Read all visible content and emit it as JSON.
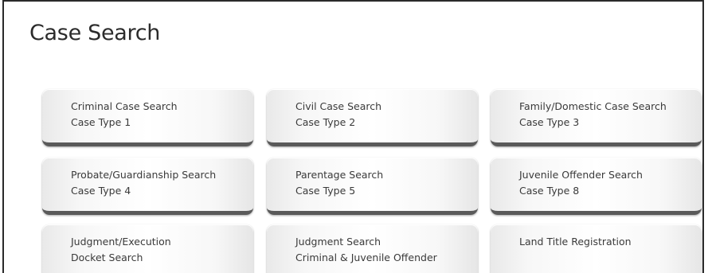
{
  "page": {
    "title": "Case Search"
  },
  "tiles": [
    {
      "line1": "Criminal Case Search",
      "line2": "Case Type 1"
    },
    {
      "line1": "Civil Case Search",
      "line2": "Case Type 2"
    },
    {
      "line1": "Family/Domestic Case Search",
      "line2": "Case Type 3"
    },
    {
      "line1": "Probate/Guardianship Search",
      "line2": "Case Type 4"
    },
    {
      "line1": "Parentage Search",
      "line2": "Case Type 5"
    },
    {
      "line1": "Juvenile Offender Search",
      "line2": "Case Type 8"
    },
    {
      "line1": "Judgment/Execution",
      "line2": "Docket Search"
    },
    {
      "line1": "Judgment Search",
      "line2": "Criminal & Juvenile Offender"
    },
    {
      "line1": "Land Title Registration",
      "line2": ""
    }
  ],
  "colors": {
    "title_text": "#2b2b2b",
    "tile_text": "#3a3a3a",
    "tile_shadow": "#5a5a5a",
    "frame_border": "#2a2a2a"
  }
}
